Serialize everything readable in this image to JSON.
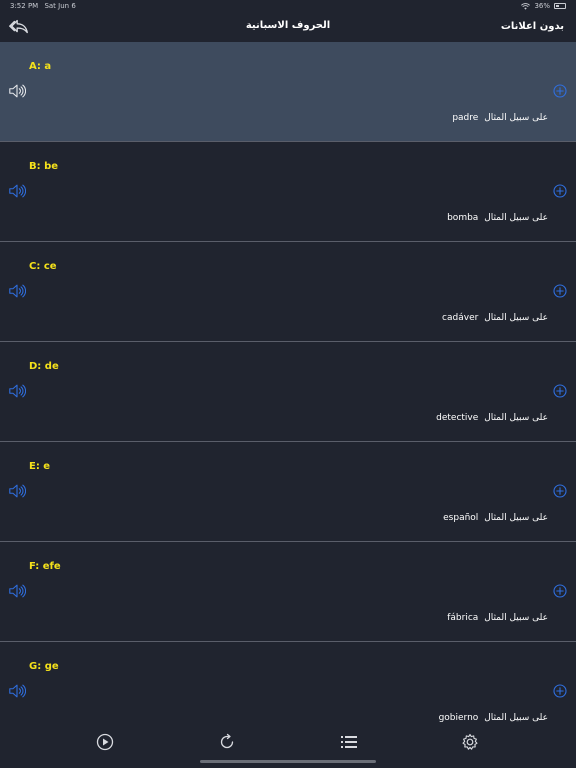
{
  "status_bar": {
    "time": "3:52 PM",
    "date": "Sat Jun 6",
    "battery": "36%"
  },
  "nav": {
    "title": "الحروف الاسبانية",
    "right_label": "بدون اعلانات",
    "back_icon": "back-reply-icon"
  },
  "example_prefix": "على سبيل المثال",
  "rows": [
    {
      "letter": "A: a",
      "example": "padre",
      "selected": true
    },
    {
      "letter": "B: be",
      "example": "bomba"
    },
    {
      "letter": "C: ce",
      "example": "cadáver"
    },
    {
      "letter": "D: de",
      "example": "detective"
    },
    {
      "letter": "E: e",
      "example": "español"
    },
    {
      "letter": "F: efe",
      "example": "fábrica"
    },
    {
      "letter": "G: ge",
      "example": "gobierno"
    }
  ],
  "tabs": [
    {
      "name": "play-icon"
    },
    {
      "name": "replay-icon"
    },
    {
      "name": "list-icon"
    },
    {
      "name": "settings-gear-icon"
    }
  ],
  "colors": {
    "background": "#20242f",
    "selected_row": "#3e4b5e",
    "letter": "#f5e21b",
    "accent_blue": "#2f6fe0",
    "divider": "#5a5e6a"
  }
}
